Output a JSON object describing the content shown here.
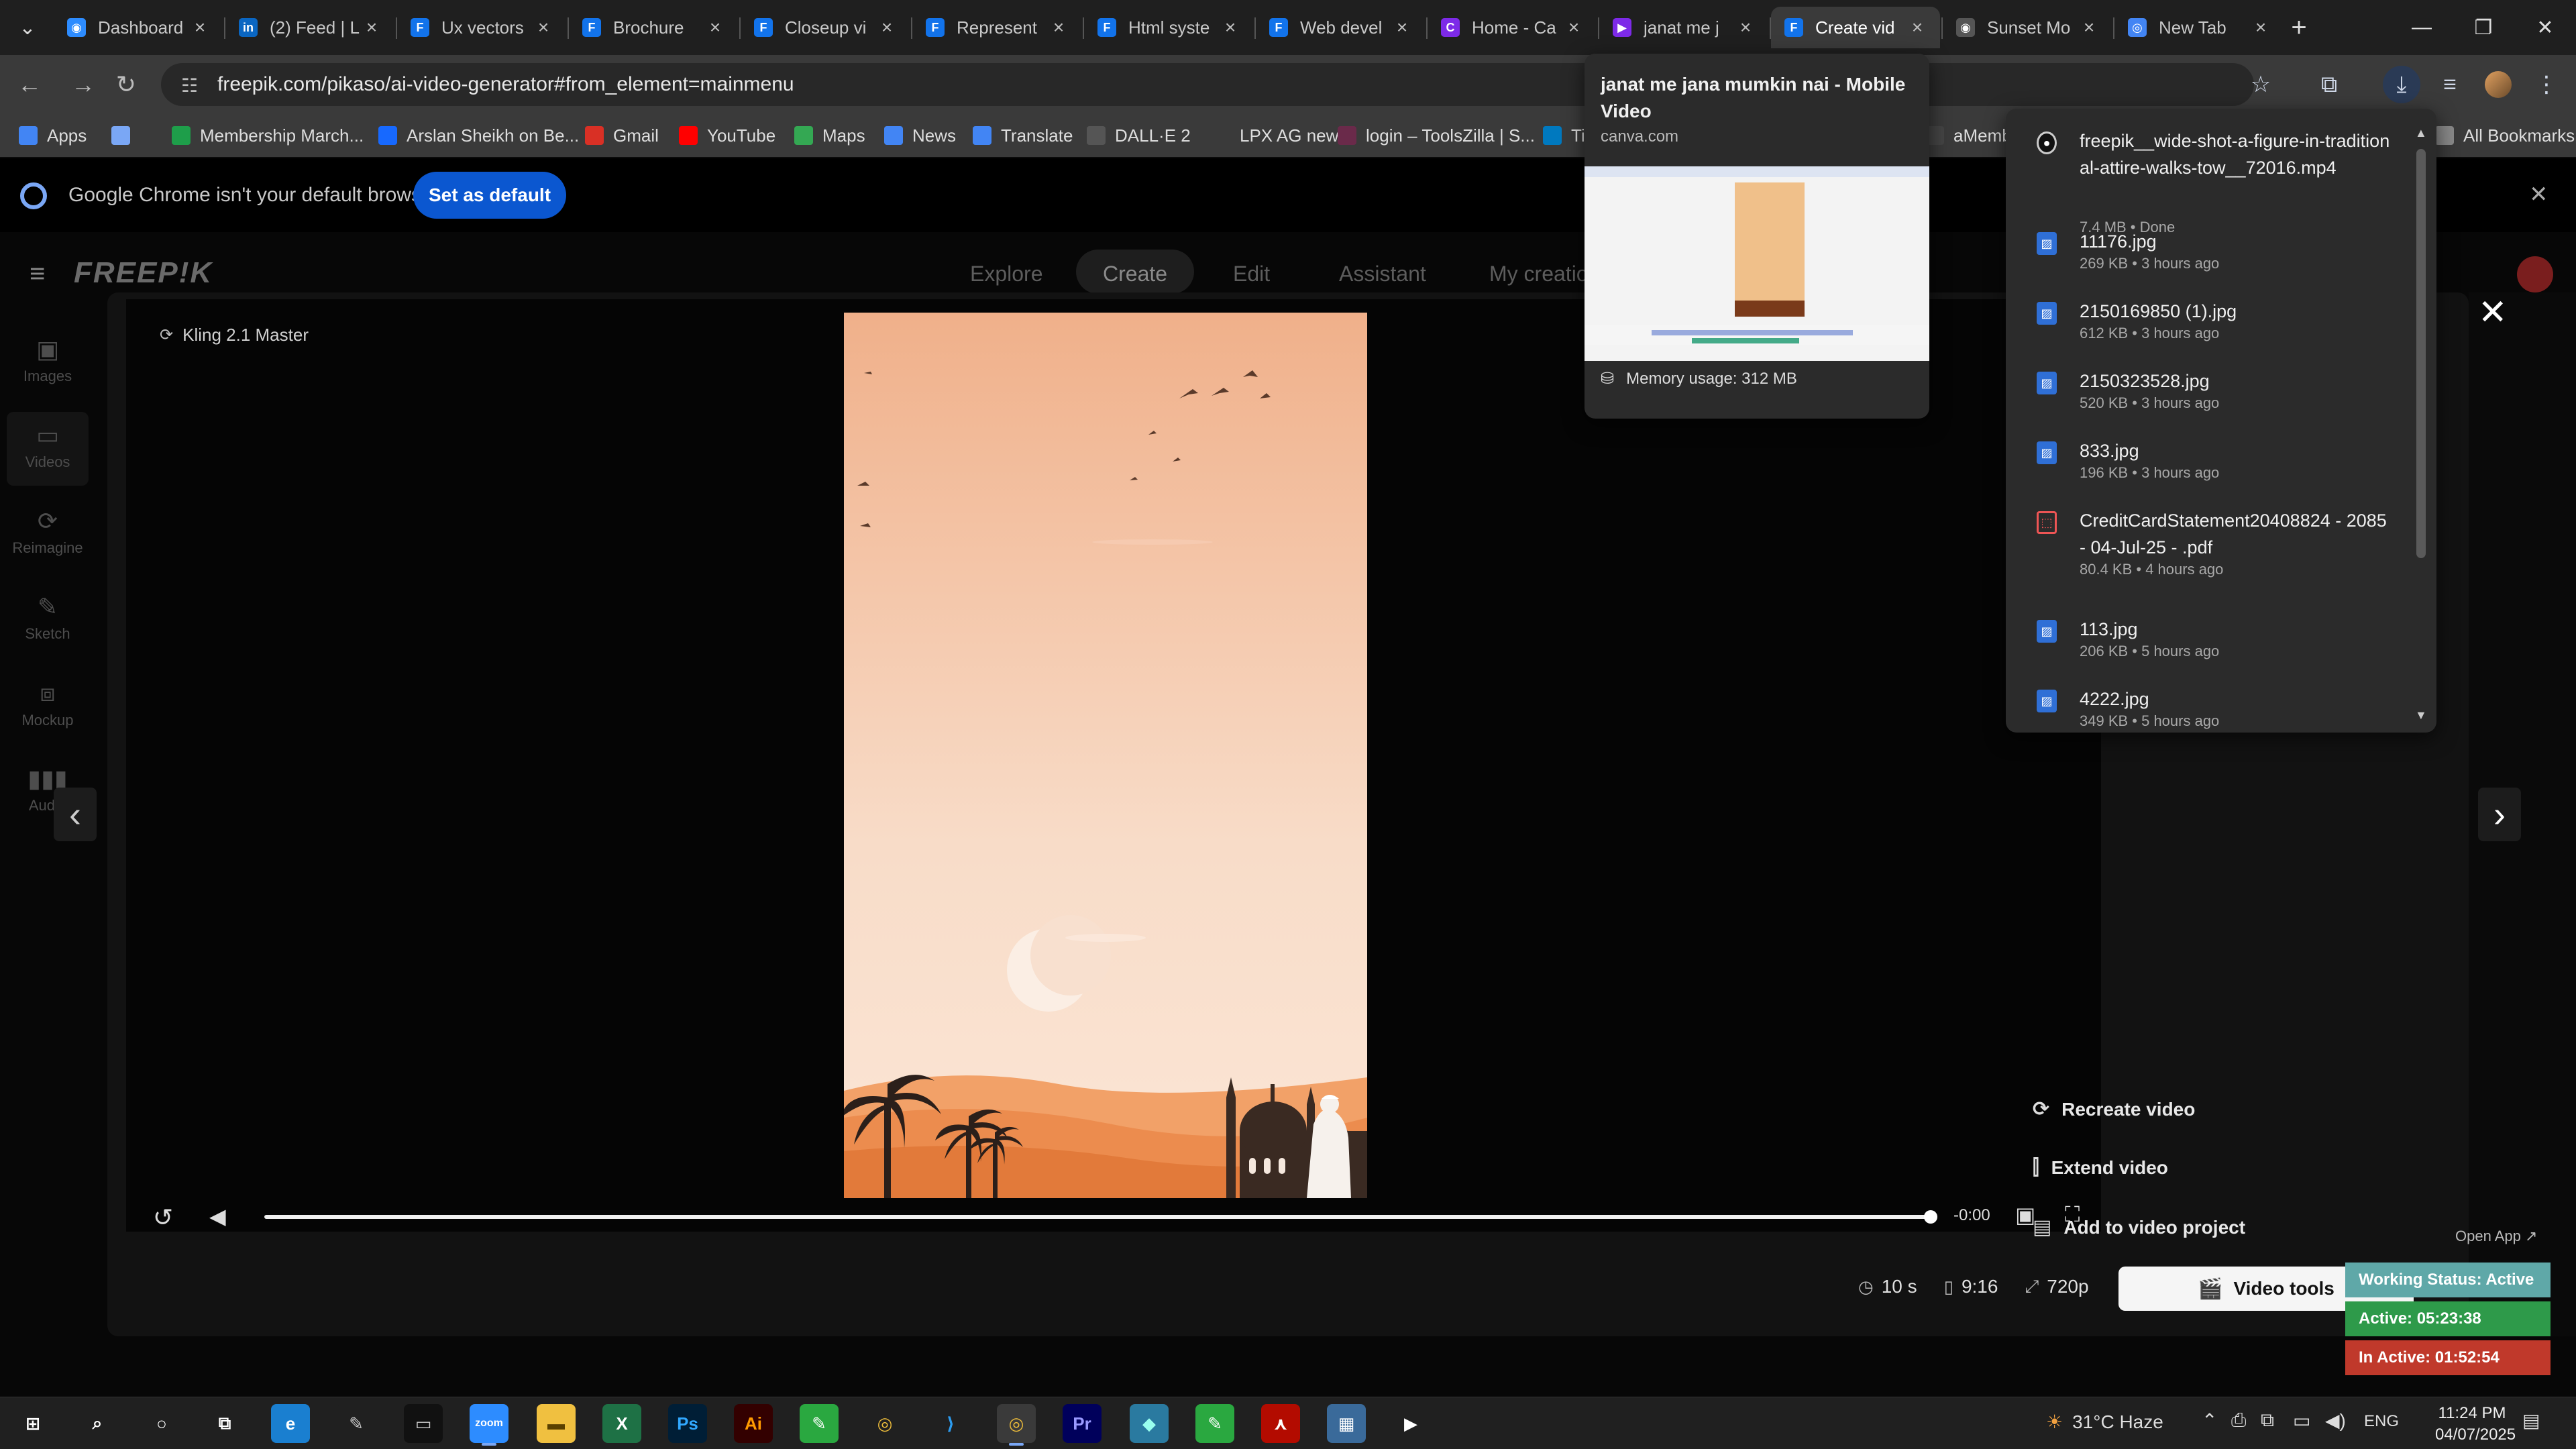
{
  "browser": {
    "tabs": [
      {
        "title": "Dashboard",
        "icon": "globe-icon",
        "color": "#2d8cff"
      },
      {
        "title": "(2) Feed | L",
        "icon": "linkedin-icon",
        "color": "#0a66c2"
      },
      {
        "title": "Ux vectors",
        "icon": "freepik-icon",
        "color": "#1273eb"
      },
      {
        "title": "Brochure",
        "icon": "freepik-icon",
        "color": "#1273eb"
      },
      {
        "title": "Closeup vi",
        "icon": "freepik-icon",
        "color": "#1273eb"
      },
      {
        "title": "Represent",
        "icon": "freepik-icon",
        "color": "#1273eb"
      },
      {
        "title": "Html syste",
        "icon": "freepik-icon",
        "color": "#1273eb"
      },
      {
        "title": "Web devel",
        "icon": "freepik-icon",
        "color": "#1273eb"
      },
      {
        "title": "Home - Ca",
        "icon": "canva-icon",
        "color": "#7d2ae8"
      },
      {
        "title": "janat me j",
        "icon": "canva-video-icon",
        "color": "#7d2ae8"
      },
      {
        "title": "Create vid",
        "icon": "freepik-icon",
        "color": "#1273eb"
      },
      {
        "title": "Sunset Mo",
        "icon": "globe-icon",
        "color": "#555555"
      },
      {
        "title": "New Tab",
        "icon": "chrome-icon",
        "color": "#4285f4"
      }
    ],
    "active_tab_index": 10,
    "url": "freepik.com/pikaso/ai-video-generator#from_element=mainmenu",
    "bookmarks": [
      {
        "label": "Apps",
        "icon": "apps-grid-icon"
      },
      {
        "label": "",
        "icon": "grid-icon"
      },
      {
        "label": "Membership March...",
        "icon": "bookmark-green-icon"
      },
      {
        "label": "Arslan Sheikh on Be...",
        "icon": "behance-icon"
      },
      {
        "label": "Gmail",
        "icon": "gmail-icon"
      },
      {
        "label": "YouTube",
        "icon": "youtube-icon"
      },
      {
        "label": "Maps",
        "icon": "maps-icon"
      },
      {
        "label": "News",
        "icon": "news-icon"
      },
      {
        "label": "Translate",
        "icon": "translate-icon"
      },
      {
        "label": "DALL·E 2",
        "icon": "openai-icon"
      },
      {
        "label": "LPX AG new",
        "icon": "blank-icon"
      },
      {
        "label": "login – ToolsZilla | S...",
        "icon": "toolszilla-icon"
      },
      {
        "label": "Ti",
        "icon": "trello-icon"
      },
      {
        "label": "aMemb",
        "icon": "amember-icon"
      },
      {
        "label": "All Bookmarks",
        "icon": "folder-icon"
      }
    ],
    "infobar": {
      "text": "Google Chrome isn't your default browser",
      "button": "Set as default"
    }
  },
  "app": {
    "logo": "FREEP!K",
    "nav": [
      "Explore",
      "Create",
      "Edit",
      "Assistant",
      "My creatio"
    ],
    "sidebar": [
      {
        "label": "Images",
        "icon": "image-icon"
      },
      {
        "label": "Videos",
        "icon": "video-icon"
      },
      {
        "label": "Reimagine",
        "icon": "refresh-icon"
      },
      {
        "label": "Sketch",
        "icon": "pencil-icon"
      },
      {
        "label": "Mockup",
        "icon": "mockup-icon"
      },
      {
        "label": "Audio",
        "icon": "audio-icon"
      }
    ]
  },
  "modal": {
    "model": "Kling 2.1 Master",
    "time_remaining": "-0:00",
    "playback_progress": 1.0,
    "duration": "10 s",
    "aspect": "9:16",
    "resolution": "720p",
    "actions": [
      "Recreate video",
      "Extend video",
      "Add to video project"
    ],
    "video_tools": "Video tools",
    "colors": {
      "sky": "#f0b58f",
      "dune_dark": "#e07a3c",
      "dune_light": "#f3a066"
    }
  },
  "hovercard": {
    "title": "janat me jana mumkin nai - Mobile Video",
    "domain": "canva.com",
    "memory": "Memory usage: 312 MB"
  },
  "downloads": [
    {
      "name": "freepik__wide-shot-a-figure-in-traditional-attire-walks-tow__72016.mp4",
      "meta": "7.4 MB • Done",
      "type": "video"
    },
    {
      "name": "11176.jpg",
      "meta": "269 KB • 3 hours ago",
      "type": "image"
    },
    {
      "name": "2150169850 (1).jpg",
      "meta": "612 KB • 3 hours ago",
      "type": "image"
    },
    {
      "name": "2150323528.jpg",
      "meta": "520 KB • 3 hours ago",
      "type": "image"
    },
    {
      "name": "833.jpg",
      "meta": "196 KB • 3 hours ago",
      "type": "image"
    },
    {
      "name": "CreditCardStatement20408824 - 2085 - 04-Jul-25 - .pdf",
      "meta": "80.4 KB • 4 hours ago",
      "type": "pdf"
    },
    {
      "name": "113.jpg",
      "meta": "206 KB • 5 hours ago",
      "type": "image"
    },
    {
      "name": "4222.jpg",
      "meta": "349 KB • 5 hours ago",
      "type": "image"
    }
  ],
  "status_widget": {
    "open_app": "Open App ↗",
    "working": "Working Status: Active",
    "active": "Active: 05:23:38",
    "inactive": "In Active: 01:52:54",
    "colors": {
      "working": "#5fa8a8",
      "active": "#2e9a4a",
      "inactive": "#c0392b"
    }
  },
  "taskbar": {
    "apps": [
      "windows-start-icon",
      "search-icon",
      "cortana-icon",
      "task-view-icon",
      "edge-icon",
      "pen-icon",
      "terminal-icon",
      "zoom-icon",
      "file-explorer-icon",
      "excel-icon",
      "photoshop-icon",
      "illustrator-icon",
      "green-app-icon",
      "chrome-icon",
      "vscode-icon",
      "chrome-profile-icon",
      "premiere-icon",
      "diamond-app-icon",
      "green-app-2-icon",
      "acrobat-icon",
      "calculator-icon",
      "media-player-icon"
    ],
    "weather": "31°C Haze",
    "language": "ENG",
    "time": "11:24 PM",
    "date": "04/07/2025"
  }
}
